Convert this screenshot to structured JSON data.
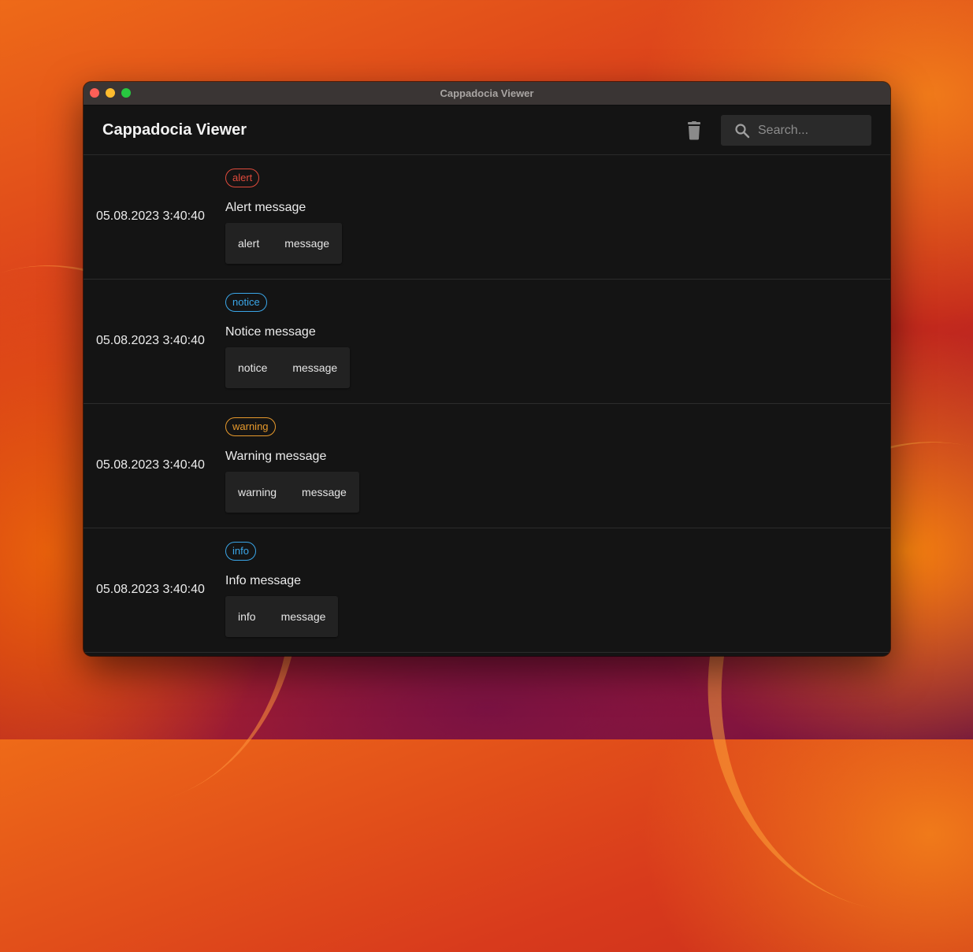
{
  "window": {
    "title": "Cappadocia Viewer"
  },
  "header": {
    "title": "Cappadocia Viewer",
    "search_placeholder": "Search...",
    "delete_icon": "trash-icon",
    "search_icon": "search-icon"
  },
  "colors": {
    "alert": "#e04b3c",
    "notice": "#3aa6e8",
    "warning": "#e89a2c",
    "info": "#3aa6e8"
  },
  "logs": [
    {
      "timestamp": "05.08.2023 3:40:40",
      "level": "alert",
      "message": "Alert message",
      "tags": [
        "alert",
        "message"
      ]
    },
    {
      "timestamp": "05.08.2023 3:40:40",
      "level": "notice",
      "message": "Notice message",
      "tags": [
        "notice",
        "message"
      ]
    },
    {
      "timestamp": "05.08.2023 3:40:40",
      "level": "warning",
      "message": "Warning message",
      "tags": [
        "warning",
        "message"
      ]
    },
    {
      "timestamp": "05.08.2023 3:40:40",
      "level": "info",
      "message": "Info message",
      "tags": [
        "info",
        "message"
      ]
    }
  ]
}
